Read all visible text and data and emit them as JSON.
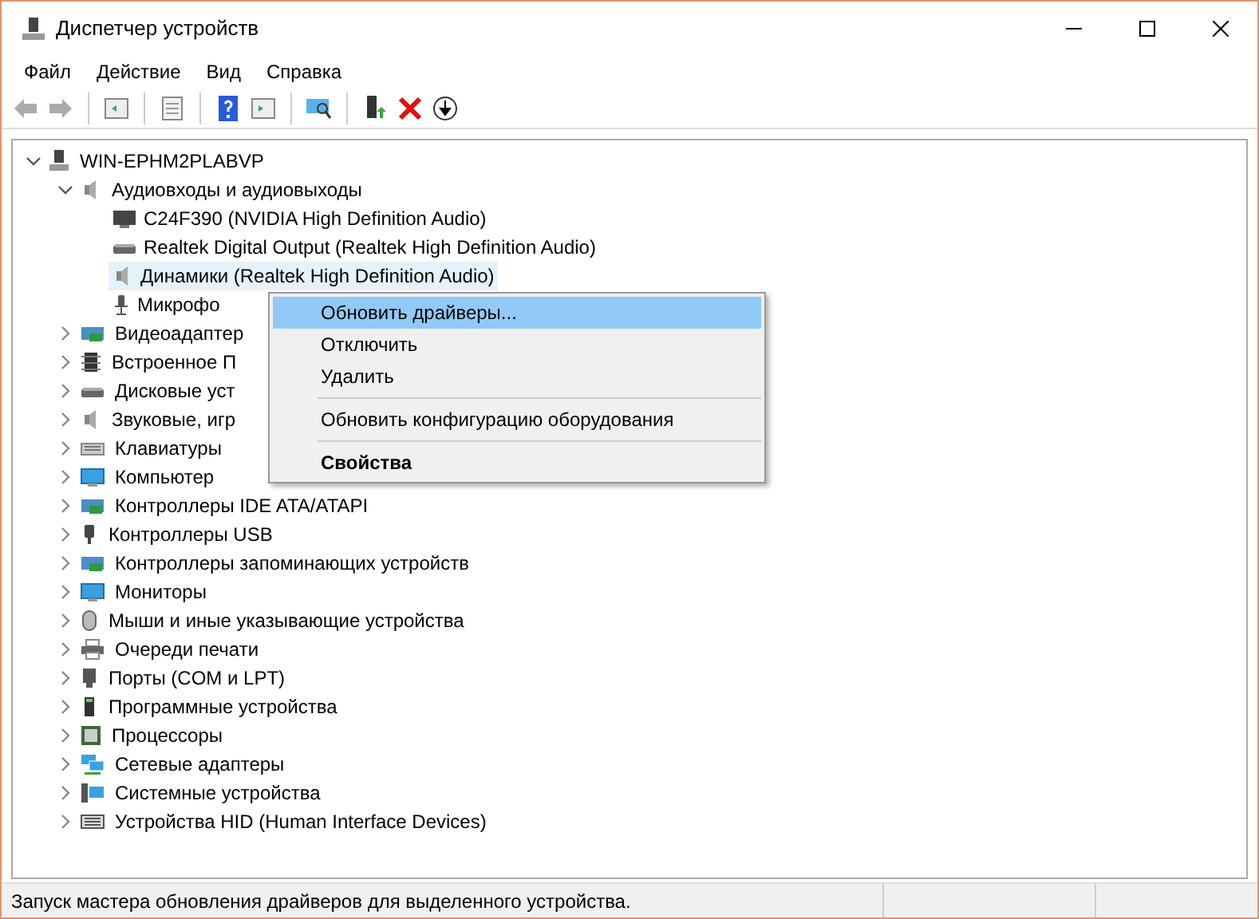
{
  "window": {
    "title": "Диспетчер устройств"
  },
  "menu_bar": [
    "Файл",
    "Действие",
    "Вид",
    "Справка"
  ],
  "tree": {
    "label": "WIN-EPHM2PLABVP",
    "expanded": true,
    "children": [
      {
        "label": "Аудиовходы и аудиовыходы",
        "expanded": true,
        "children": [
          {
            "label": "C24F390 (NVIDIA High Definition Audio)",
            "selected": false
          },
          {
            "label": "Realtek Digital Output (Realtek High Definition Audio)",
            "selected": false
          },
          {
            "label": "Динамики (Realtek High Definition Audio)",
            "selected": true
          },
          {
            "label": "Микрофо",
            "selected": false
          }
        ]
      },
      {
        "label": "Видеоадаптер",
        "expanded": false
      },
      {
        "label": "Встроенное П",
        "expanded": false
      },
      {
        "label": "Дисковые уст",
        "expanded": false
      },
      {
        "label": "Звуковые, игр",
        "expanded": false
      },
      {
        "label": "Клавиатуры",
        "expanded": false
      },
      {
        "label": "Компьютер",
        "expanded": false
      },
      {
        "label": "Контроллеры IDE ATA/ATAPI",
        "expanded": false
      },
      {
        "label": "Контроллеры USB",
        "expanded": false
      },
      {
        "label": "Контроллеры запоминающих устройств",
        "expanded": false
      },
      {
        "label": "Мониторы",
        "expanded": false
      },
      {
        "label": "Мыши и иные указывающие устройства",
        "expanded": false
      },
      {
        "label": "Очереди печати",
        "expanded": false
      },
      {
        "label": "Порты (COM и LPT)",
        "expanded": false
      },
      {
        "label": "Программные устройства",
        "expanded": false
      },
      {
        "label": "Процессоры",
        "expanded": false
      },
      {
        "label": "Сетевые адаптеры",
        "expanded": false
      },
      {
        "label": "Системные устройства",
        "expanded": false
      },
      {
        "label": "Устройства HID (Human Interface Devices)",
        "expanded": false
      }
    ]
  },
  "context_menu": {
    "groups": [
      [
        {
          "label": "Обновить драйверы...",
          "selected": true,
          "bold": false
        },
        {
          "label": "Отключить",
          "selected": false,
          "bold": false
        },
        {
          "label": "Удалить",
          "selected": false,
          "bold": false
        }
      ],
      [
        {
          "label": "Обновить конфигурацию оборудования",
          "selected": false,
          "bold": false
        }
      ],
      [
        {
          "label": "Свойства",
          "selected": false,
          "bold": true
        }
      ]
    ]
  },
  "status_bar": {
    "text": "Запуск мастера обновления драйверов для выделенного устройства."
  }
}
